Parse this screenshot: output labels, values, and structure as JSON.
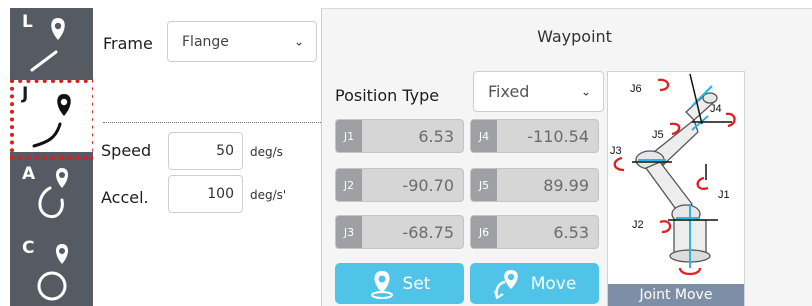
{
  "modes": [
    {
      "letter": "L",
      "icon": "linear-move-icon",
      "active": false
    },
    {
      "letter": "J",
      "icon": "joint-move-icon",
      "active": true
    },
    {
      "letter": "A",
      "icon": "arc-move-icon",
      "active": false
    },
    {
      "letter": "C",
      "icon": "circle-move-icon",
      "active": false
    }
  ],
  "settings": {
    "frame_label": "Frame",
    "frame_value": "Flange",
    "speed_label": "Speed",
    "speed_value": "50",
    "speed_unit": "deg/s",
    "accel_label": "Accel.",
    "accel_value": "100",
    "accel_unit": "deg/s'"
  },
  "waypoint": {
    "title": "Waypoint",
    "position_type_label": "Position Type",
    "position_type_value": "Fixed",
    "joints": [
      {
        "name": "J1",
        "value": "6.53"
      },
      {
        "name": "J4",
        "value": "-110.54"
      },
      {
        "name": "J2",
        "value": "-90.70"
      },
      {
        "name": "J5",
        "value": "89.99"
      },
      {
        "name": "J3",
        "value": "-68.75"
      },
      {
        "name": "J6",
        "value": "6.53"
      }
    ],
    "set_label": "Set",
    "move_label": "Move",
    "diagram_labels": [
      "J6",
      "J4",
      "J5",
      "J3",
      "J1",
      "J2"
    ],
    "diagram_caption": "Joint Move"
  },
  "colors": {
    "mode_strip": "#565b63",
    "active_highlight": "#e11b1b",
    "action_button": "#4fc4e8",
    "joint_tag": "#9ea0a3",
    "diagram_caption": "#7d8ea6",
    "rotation_arrow": "#e02020",
    "joint_axis": "#27b6e6"
  }
}
